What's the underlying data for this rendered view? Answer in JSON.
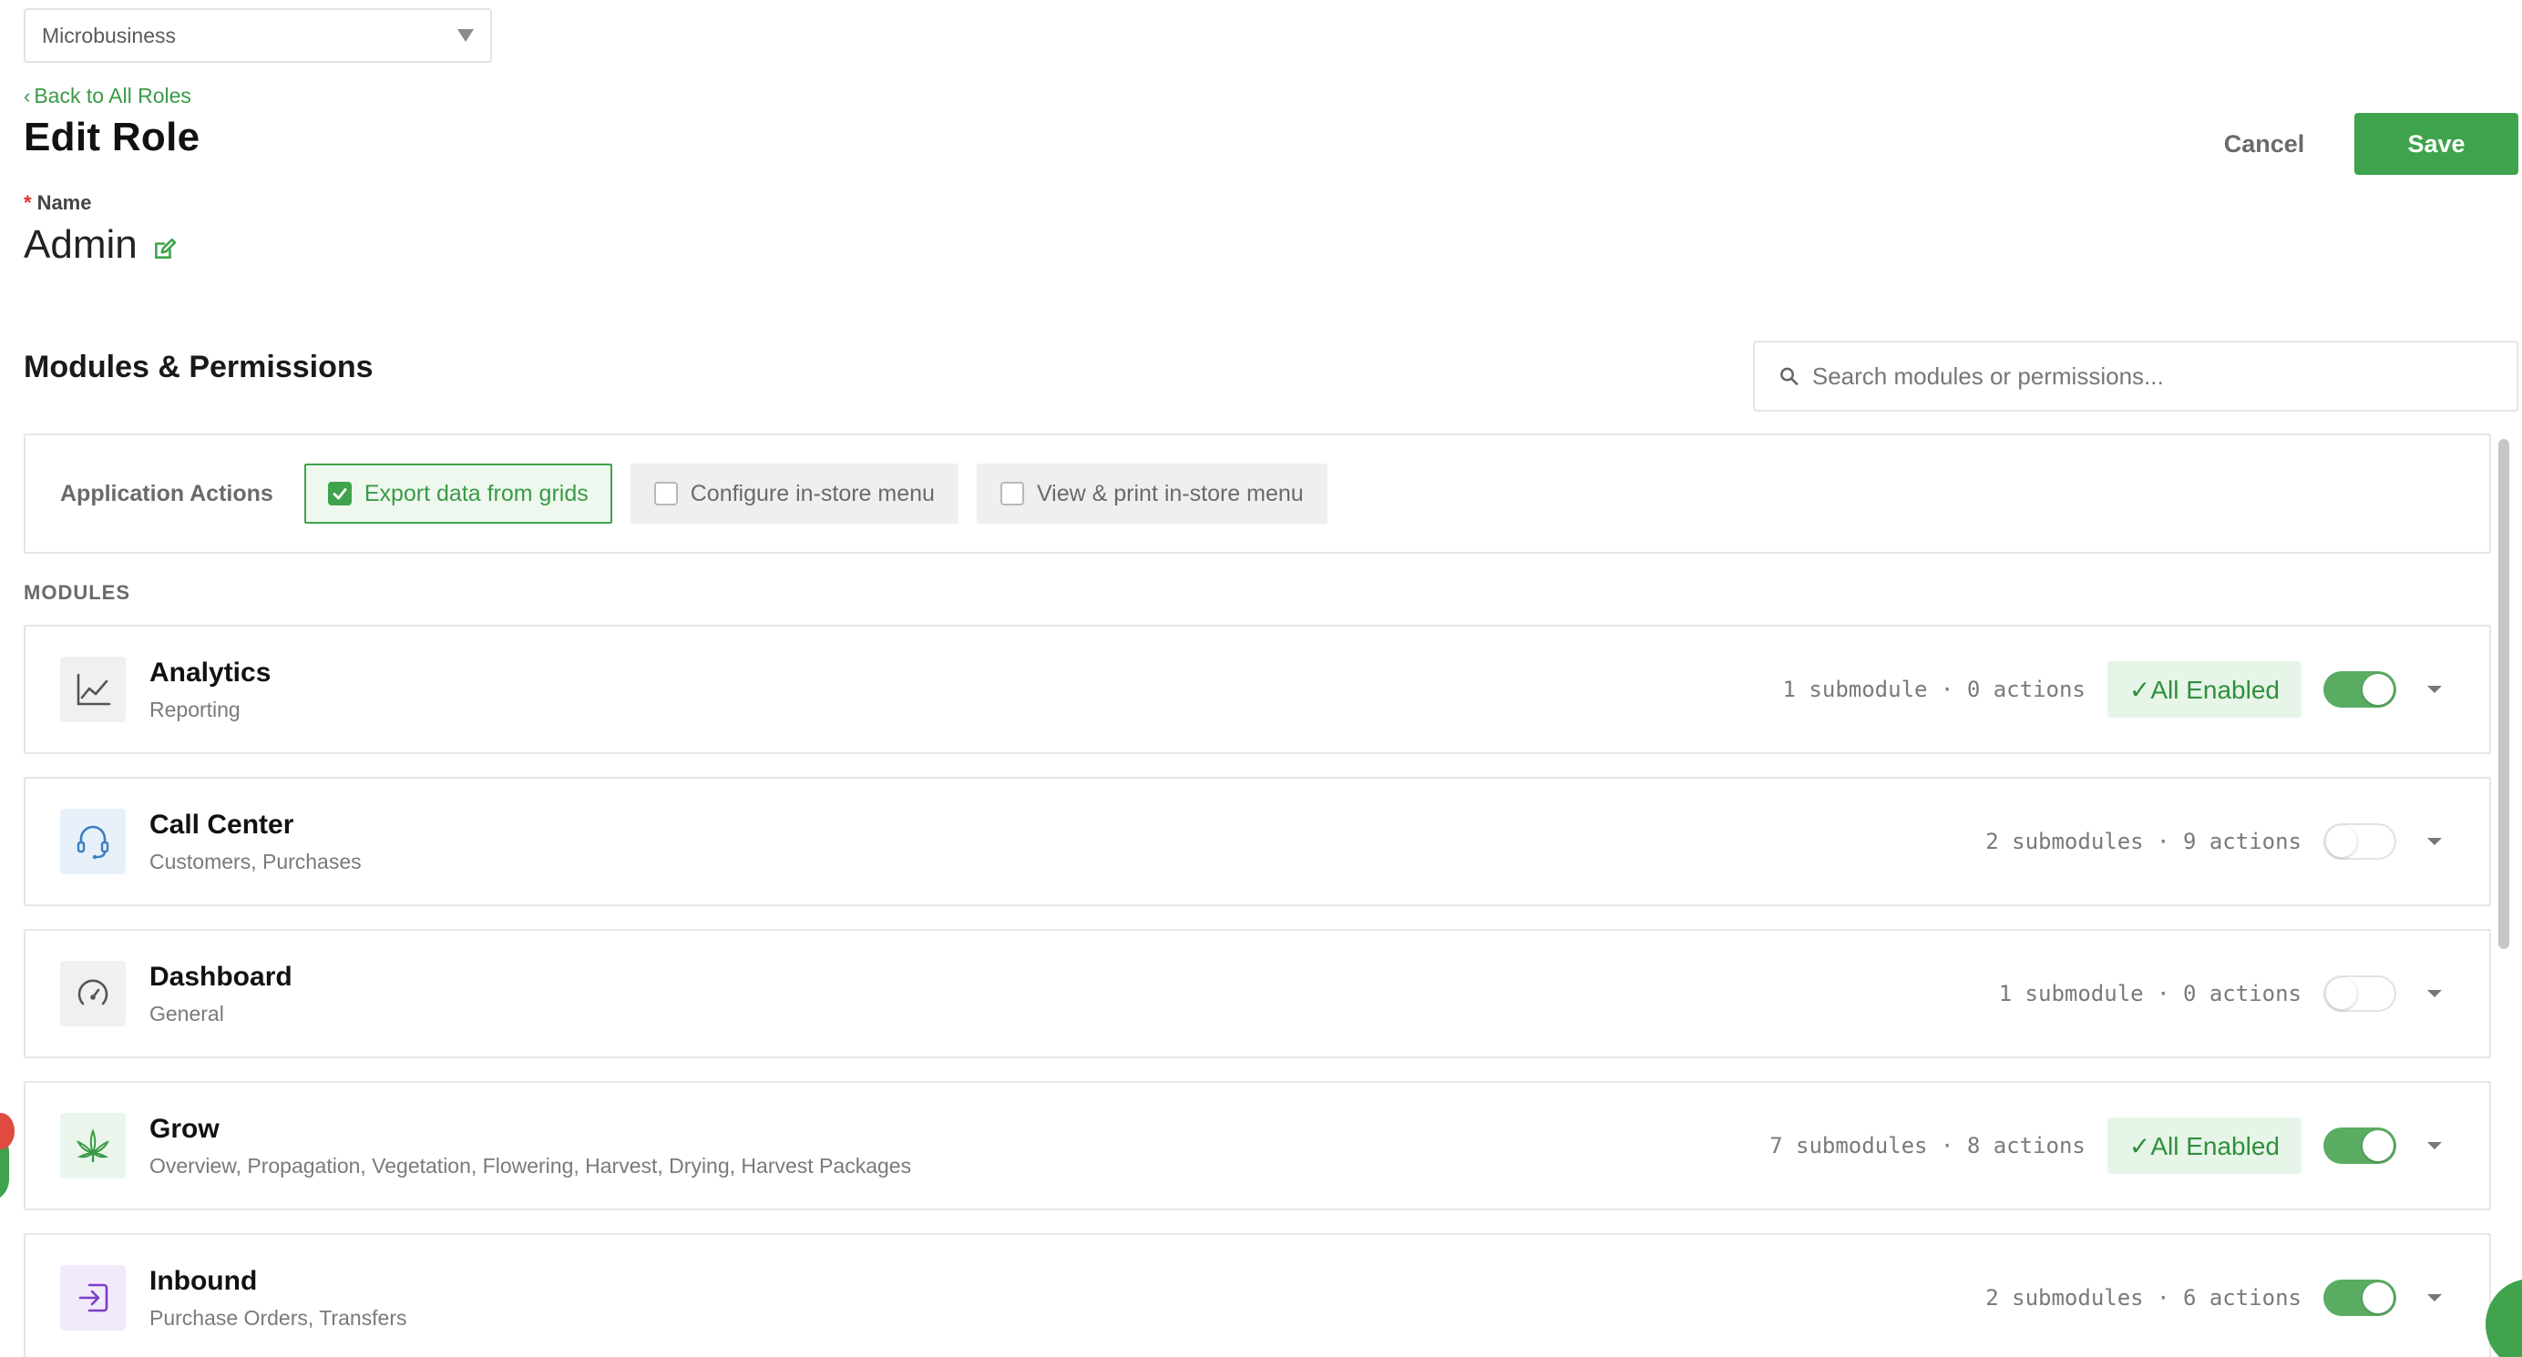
{
  "header": {
    "business_select": "Microbusiness",
    "back_link": "Back to All Roles",
    "page_title": "Edit Role",
    "cancel_label": "Cancel",
    "save_label": "Save"
  },
  "name_field": {
    "label": "Name",
    "required_mark": "*",
    "value": "Admin"
  },
  "permissions": {
    "section_title": "Modules & Permissions",
    "search_placeholder": "Search modules or permissions..."
  },
  "application_actions": {
    "label": "Application Actions",
    "items": [
      {
        "label": "Export data from grids",
        "checked": true
      },
      {
        "label": "Configure in-store menu",
        "checked": false
      },
      {
        "label": "View & print in-store menu",
        "checked": false
      }
    ]
  },
  "modules": {
    "heading": "MODULES",
    "items": [
      {
        "name": "Analytics",
        "sub": "Reporting",
        "count": "1 submodule · 0 actions",
        "badge": "✓All Enabled",
        "enabled": true,
        "icon": "chart-line-icon"
      },
      {
        "name": "Call Center",
        "sub": "Customers, Purchases",
        "count": "2 submodules · 9 actions",
        "badge": "",
        "enabled": false,
        "icon": "headset-icon"
      },
      {
        "name": "Dashboard",
        "sub": "General",
        "count": "1 submodule · 0 actions",
        "badge": "",
        "enabled": false,
        "icon": "gauge-icon"
      },
      {
        "name": "Grow",
        "sub": "Overview, Propagation, Vegetation, Flowering, Harvest, Drying, Harvest Packages",
        "count": "7 submodules · 8 actions",
        "badge": "✓All Enabled",
        "enabled": true,
        "icon": "cannabis-leaf-icon"
      },
      {
        "name": "Inbound",
        "sub": "Purchase Orders, Transfers",
        "count": "2 submodules · 6 actions",
        "badge": "",
        "enabled": true,
        "icon": "sign-in-icon"
      }
    ]
  },
  "colors": {
    "accent": "#3fa34d",
    "link": "#3a9a45",
    "required": "#d9322c"
  }
}
